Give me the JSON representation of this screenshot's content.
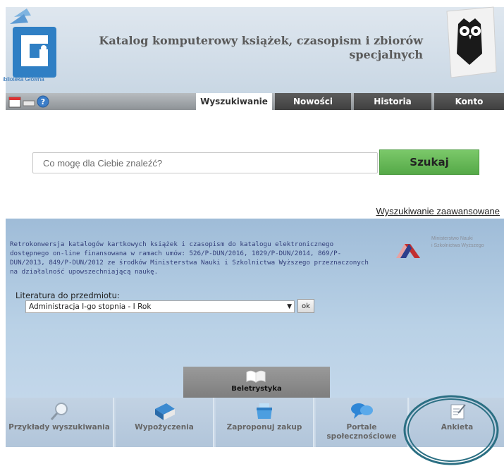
{
  "header": {
    "logo_caption": "iblioteka Główna",
    "title_line1": "Katalog komputerowy książek, czasopism i zbiorów",
    "title_line2": "specjalnych"
  },
  "tabs": [
    {
      "label": "Wyszukiwanie",
      "active": true
    },
    {
      "label": "Nowości",
      "active": false
    },
    {
      "label": "Historia",
      "active": false
    },
    {
      "label": "Konto",
      "active": false
    }
  ],
  "search": {
    "placeholder": "Co mogę dla Ciebie znaleźć?",
    "button_label": "Szukaj",
    "advanced_link": "Wyszukiwanie zaawansowane"
  },
  "info": {
    "text": "Retrokonwersja katalogów kartkowych książek i czasopism do katalogu elektronicznego dostępnego on-line finansowana w ramach umów: 526/P-DUN/2016, 1029/P-DUN/2014, 869/P-DUN/2013, 849/P-DUN/2012 ze środków Ministerstwa Nauki i Szkolnictwa Wyższego przeznaczonych na działalność upowszechniającą naukę.",
    "ministry_line1": "Ministerstwo Nauki",
    "ministry_line2": "i Szkolnictwa Wyższego"
  },
  "literature": {
    "label": "Literatura do przedmiotu:",
    "selected": "Administracja I-go stopnia - I Rok",
    "ok_label": "ok"
  },
  "fiction": {
    "label": "Beletrystyka"
  },
  "bottom_tiles": [
    {
      "label": "Przykłady wyszukiwania",
      "icon": "magnifier-icon"
    },
    {
      "label": "Wypożyczenia",
      "icon": "book-icon"
    },
    {
      "label": "Zaproponuj zakup",
      "icon": "cart-icon"
    },
    {
      "label": "Portale społecznościowe",
      "icon": "speech-bubbles-icon"
    },
    {
      "label": "Ankieta",
      "icon": "survey-icon"
    }
  ],
  "colors": {
    "accent_green": "#5fb552",
    "header_blue": "#c9d7e4",
    "panel_blue": "#b9d1e6",
    "info_text": "#333f7a",
    "highlight_teal": "#2b6f83"
  }
}
